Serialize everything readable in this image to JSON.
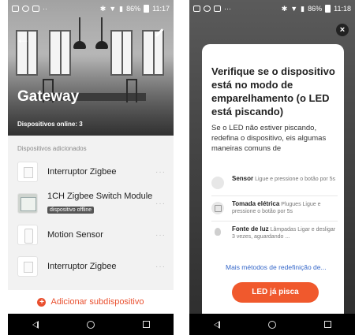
{
  "status_bar": {
    "battery": "86%",
    "time_left": "11:17",
    "time_right": "11:18"
  },
  "left": {
    "title": "Gateway",
    "online": "Dispositivos online: 3",
    "section_label": "Dispositivos adicionados",
    "devices": [
      {
        "name": "Interruptor Zigbee",
        "badge": "",
        "icon": "switch-icon"
      },
      {
        "name": "1CH Zigbee Switch Module",
        "badge": "dispositivo offline",
        "icon": "module-icon"
      },
      {
        "name": "Motion Sensor",
        "badge": "",
        "icon": "sensor-icon"
      },
      {
        "name": "Interruptor Zigbee",
        "badge": "",
        "icon": "switch-icon"
      }
    ],
    "more_symbol": "···",
    "add_label": "Adicionar subdispositivo"
  },
  "right": {
    "dialog_title": "Verifique se o dispositivo está no modo de emparelhamento (o LED está piscando)",
    "dialog_desc": "Se o LED não estiver piscando, redefina o dispositivo, eis algumas maneiras comuns de",
    "methods": [
      {
        "title": "Sensor",
        "desc": "Ligue e pressione o botão por 5s",
        "icon": "sensor-icon"
      },
      {
        "title": "Tomada elétrica",
        "desc": "Plugues Ligue e pressione o botão por 5s",
        "icon": "plug-icon"
      },
      {
        "title": "Fonte de luz",
        "desc": "Lâmpadas Ligar e desligar 3 vezes, aguardando ...",
        "icon": "bulb-icon"
      }
    ],
    "more_methods": "Mais métodos de redefinição de...",
    "cta": "LED já pisca",
    "close_symbol": "×"
  },
  "colors": {
    "accent": "#f0592d",
    "link": "#3567c9",
    "add": "#e9502f"
  }
}
